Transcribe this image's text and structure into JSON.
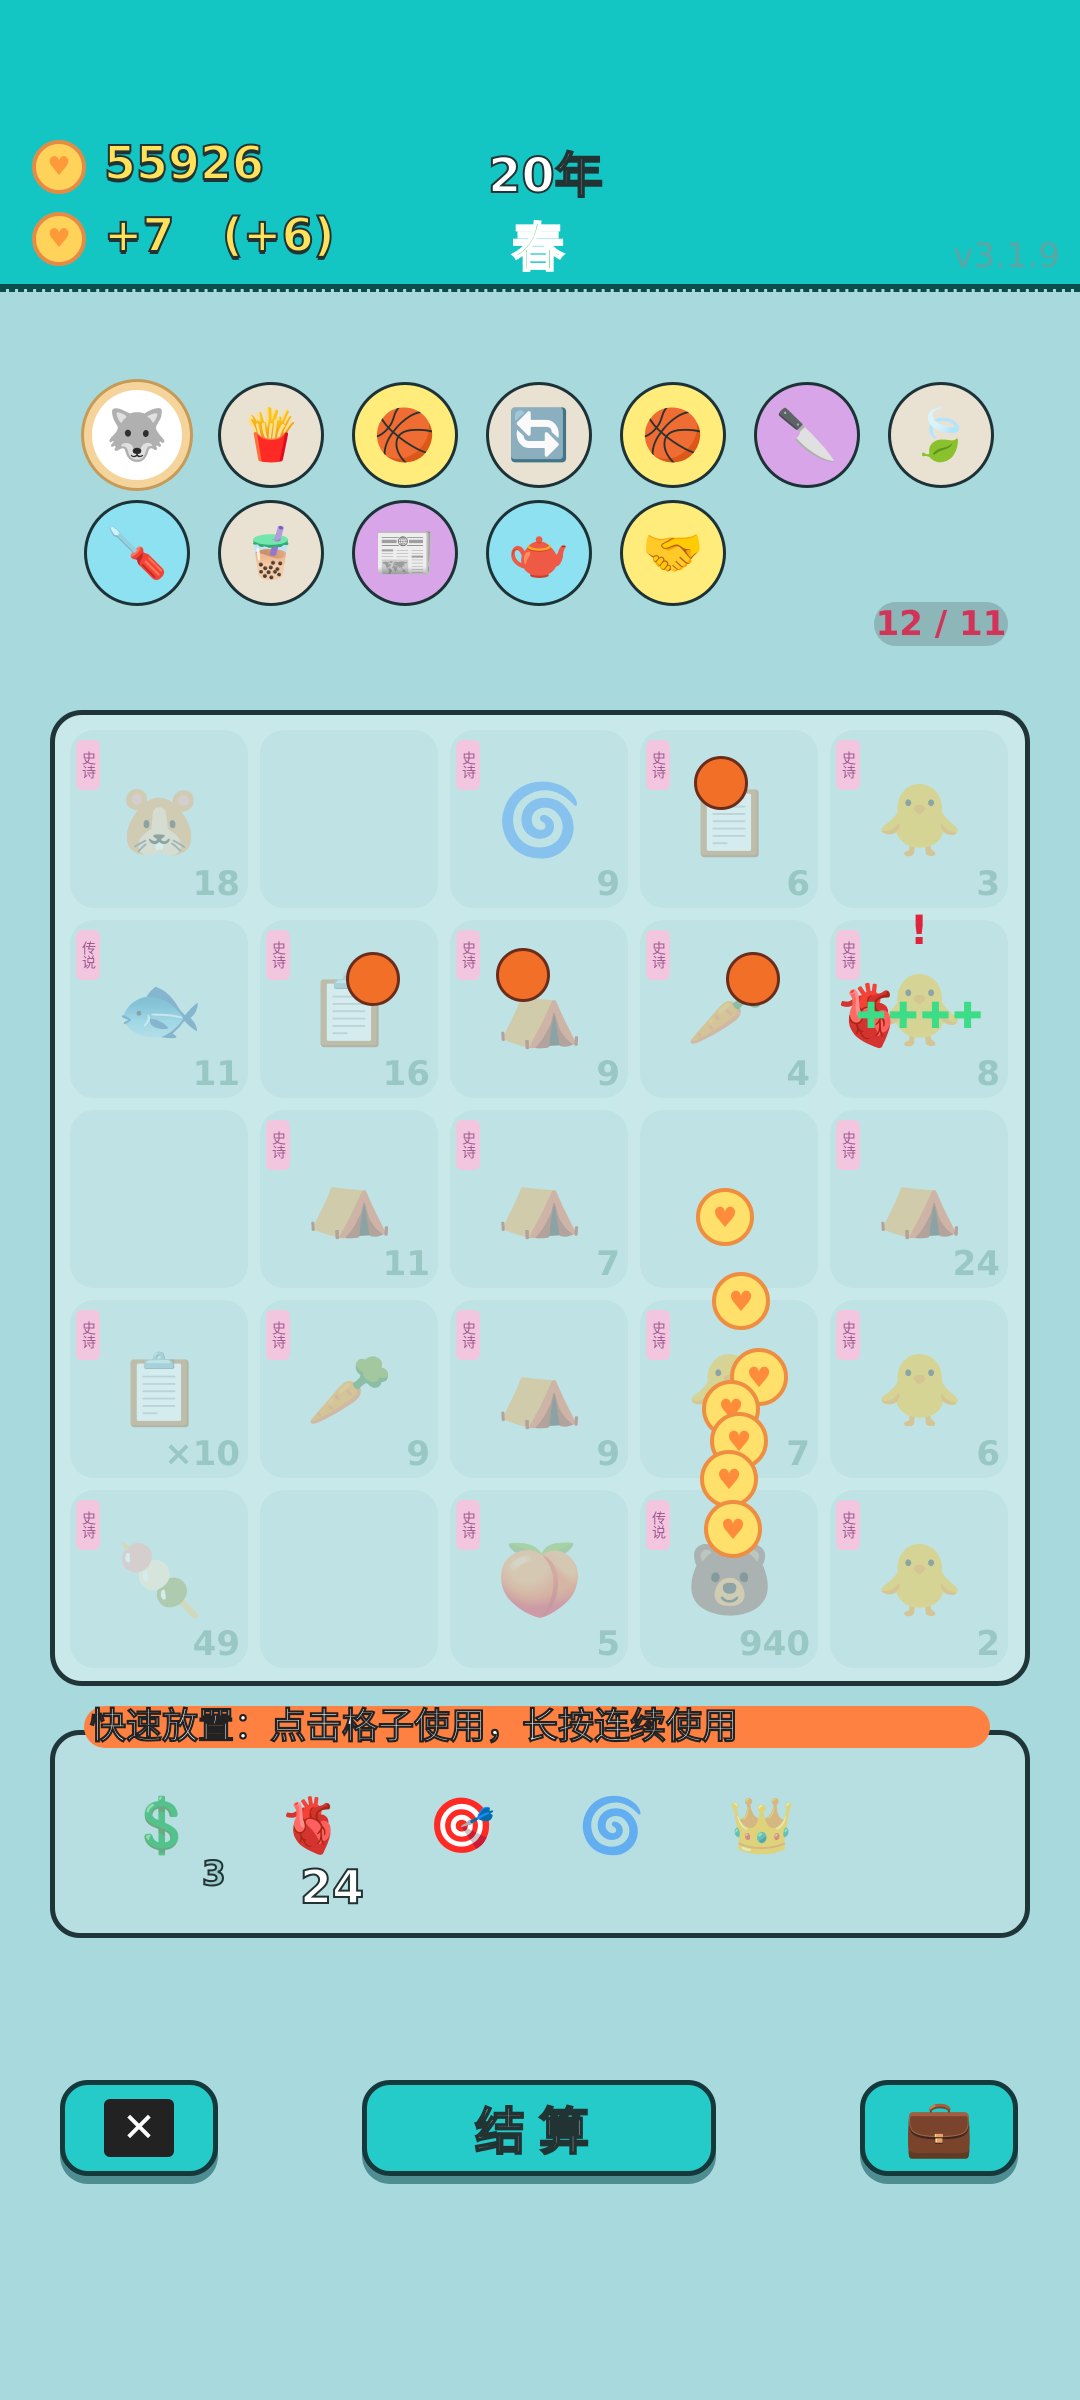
{
  "header": {
    "coins": "55926",
    "income": "+7",
    "income_bonus": "(+6)",
    "year": "20年",
    "season": "春",
    "version": "v3.1.9"
  },
  "perks": [
    {
      "name": "husky-dog-icon",
      "emoji": "🐺",
      "bg": "#ffffff"
    },
    {
      "name": "french-fries-icon",
      "emoji": "🍟",
      "bg": "#e9e2d2"
    },
    {
      "name": "basketballs-icon",
      "emoji": "🏀",
      "bg": "#ffec7a"
    },
    {
      "name": "recycle-arrows-icon",
      "emoji": "🔄",
      "bg": "#e9e2d2"
    },
    {
      "name": "basketballs-icon",
      "emoji": "🏀",
      "bg": "#ffec7a"
    },
    {
      "name": "cleaver-icon",
      "emoji": "🔪",
      "bg": "#d7a5e8"
    },
    {
      "name": "leaf-icon",
      "emoji": "🍃",
      "bg": "#e9e2d2"
    },
    {
      "name": "air-pump-icon",
      "emoji": "🪛",
      "bg": "#8de1f0"
    },
    {
      "name": "bubble-tea-icon",
      "emoji": "🧋",
      "bg": "#e9e2d2"
    },
    {
      "name": "time-magazine-icon",
      "emoji": "📰",
      "bg": "#d7a5e8"
    },
    {
      "name": "milk-jug-icon",
      "emoji": "🫖",
      "bg": "#8de1f0"
    },
    {
      "name": "handshake-icon",
      "emoji": "🤝",
      "bg": "#ffec7a"
    }
  ],
  "perk_counter": "12 / 11",
  "board": {
    "cells": [
      {
        "pic": "🐹",
        "num": "18",
        "tag": "史诗"
      },
      {
        "pic": "",
        "num": "",
        "tag": ""
      },
      {
        "pic": "🌀",
        "num": "9",
        "tag": "史诗"
      },
      {
        "pic": "📋",
        "num": "6",
        "tag": "史诗"
      },
      {
        "pic": "🐥",
        "num": "3",
        "tag": "史诗"
      },
      {
        "pic": "🐟",
        "num": "11",
        "tag": "传说"
      },
      {
        "pic": "📋",
        "num": "16",
        "tag": "史诗"
      },
      {
        "pic": "⛺",
        "num": "9",
        "tag": "史诗"
      },
      {
        "pic": "🥕",
        "num": "4",
        "tag": "史诗"
      },
      {
        "pic": "🐥",
        "num": "8",
        "tag": "史诗"
      },
      {
        "pic": "",
        "num": "",
        "tag": ""
      },
      {
        "pic": "⛺",
        "num": "11",
        "tag": "史诗"
      },
      {
        "pic": "⛺",
        "num": "7",
        "tag": "史诗"
      },
      {
        "pic": "",
        "num": "",
        "tag": ""
      },
      {
        "pic": "⛺",
        "num": "24",
        "tag": "史诗"
      },
      {
        "pic": "📋",
        "num": "×10",
        "tag": "史诗"
      },
      {
        "pic": "🥕",
        "num": "9",
        "tag": "史诗"
      },
      {
        "pic": "⛺",
        "num": "9",
        "tag": "史诗"
      },
      {
        "pic": "🐥",
        "num": "7",
        "tag": "史诗"
      },
      {
        "pic": "🐥",
        "num": "6",
        "tag": "史诗"
      },
      {
        "pic": "🍡",
        "num": "49",
        "tag": "史诗"
      },
      {
        "pic": "",
        "num": "",
        "tag": ""
      },
      {
        "pic": "🍑",
        "num": "5",
        "tag": "史诗"
      },
      {
        "pic": "🐻",
        "num": "940",
        "tag": "传说"
      },
      {
        "pic": "🐥",
        "num": "2",
        "tag": "史诗"
      }
    ]
  },
  "hint_text": "快速放置：点击格子使用，长按连续使用",
  "tray": {
    "items": [
      {
        "name": "dollar-coin-icon",
        "emoji": "💲",
        "count": "3"
      },
      {
        "name": "liver-icon",
        "emoji": "🫀",
        "count": "24"
      },
      {
        "name": "target-one-icon",
        "emoji": "🎯",
        "count": ""
      },
      {
        "name": "black-hole-icon",
        "emoji": "🌀",
        "count": ""
      },
      {
        "name": "crown-icon",
        "emoji": "👑",
        "count": ""
      }
    ]
  },
  "buttons": {
    "close_icon": "✕",
    "settle": "结算",
    "bag_icon": "💼"
  }
}
